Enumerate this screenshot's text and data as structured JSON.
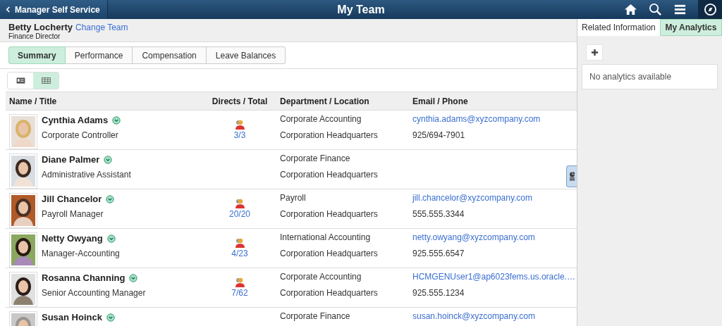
{
  "header": {
    "back_label": "Manager Self Service",
    "title": "My Team"
  },
  "manager": {
    "name": "Betty Locherty",
    "change_link": "Change Team",
    "title": "Finance Director"
  },
  "tabs": [
    {
      "label": "Summary",
      "selected": true
    },
    {
      "label": "Performance",
      "selected": false
    },
    {
      "label": "Compensation",
      "selected": false
    },
    {
      "label": "Leave Balances",
      "selected": false
    }
  ],
  "view_toggle": [
    {
      "kind": "card",
      "selected": false
    },
    {
      "kind": "grid",
      "selected": true
    }
  ],
  "table": {
    "columns": [
      "Name / Title",
      "Directs / Total",
      "Department / Location",
      "Email / Phone"
    ],
    "rows": [
      {
        "name": "Cynthia Adams",
        "title": "Corporate Controller",
        "directs": "3/3",
        "department": "Corporate Accounting",
        "location": "Corporation Headquarters",
        "email": "cynthia.adams@xyzcompany.com",
        "phone": "925/694-7901"
      },
      {
        "name": "Diane Palmer",
        "title": "Administrative Assistant",
        "department": "Corporate Finance",
        "location": "Corporation Headquarters"
      },
      {
        "name": "Jill Chancelor",
        "title": "Payroll Manager",
        "directs": "20/20",
        "department": "Payroll",
        "location": "Corporation Headquarters",
        "email": "jill.chancelor@xyzcompany.com",
        "phone": "555.555.3344"
      },
      {
        "name": "Netty Owyang",
        "title": "Manager-Accounting",
        "directs": "4/23",
        "department": "International Accounting",
        "location": "Corporation Headquarters",
        "email": "netty.owyang@xyzcompany.com",
        "phone": "925.555.6547"
      },
      {
        "name": "Rosanna Channing",
        "title": "Senior Accounting Manager",
        "directs": "7/62",
        "department": "Corporate Accounting",
        "location": "Corporation Headquarters",
        "email": "HCMGENUser1@ap6023fems.us.oracle.…",
        "phone": "925.555.1234"
      },
      {
        "name": "Susan Hoinck",
        "department": "Corporate Finance",
        "email": "susan.hoinck@xyzcompany.com"
      }
    ]
  },
  "side_panel": {
    "tabs": [
      {
        "label": "Related Information",
        "selected": false
      },
      {
        "label": "My Analytics",
        "selected": true
      }
    ],
    "message": "No analytics available"
  }
}
